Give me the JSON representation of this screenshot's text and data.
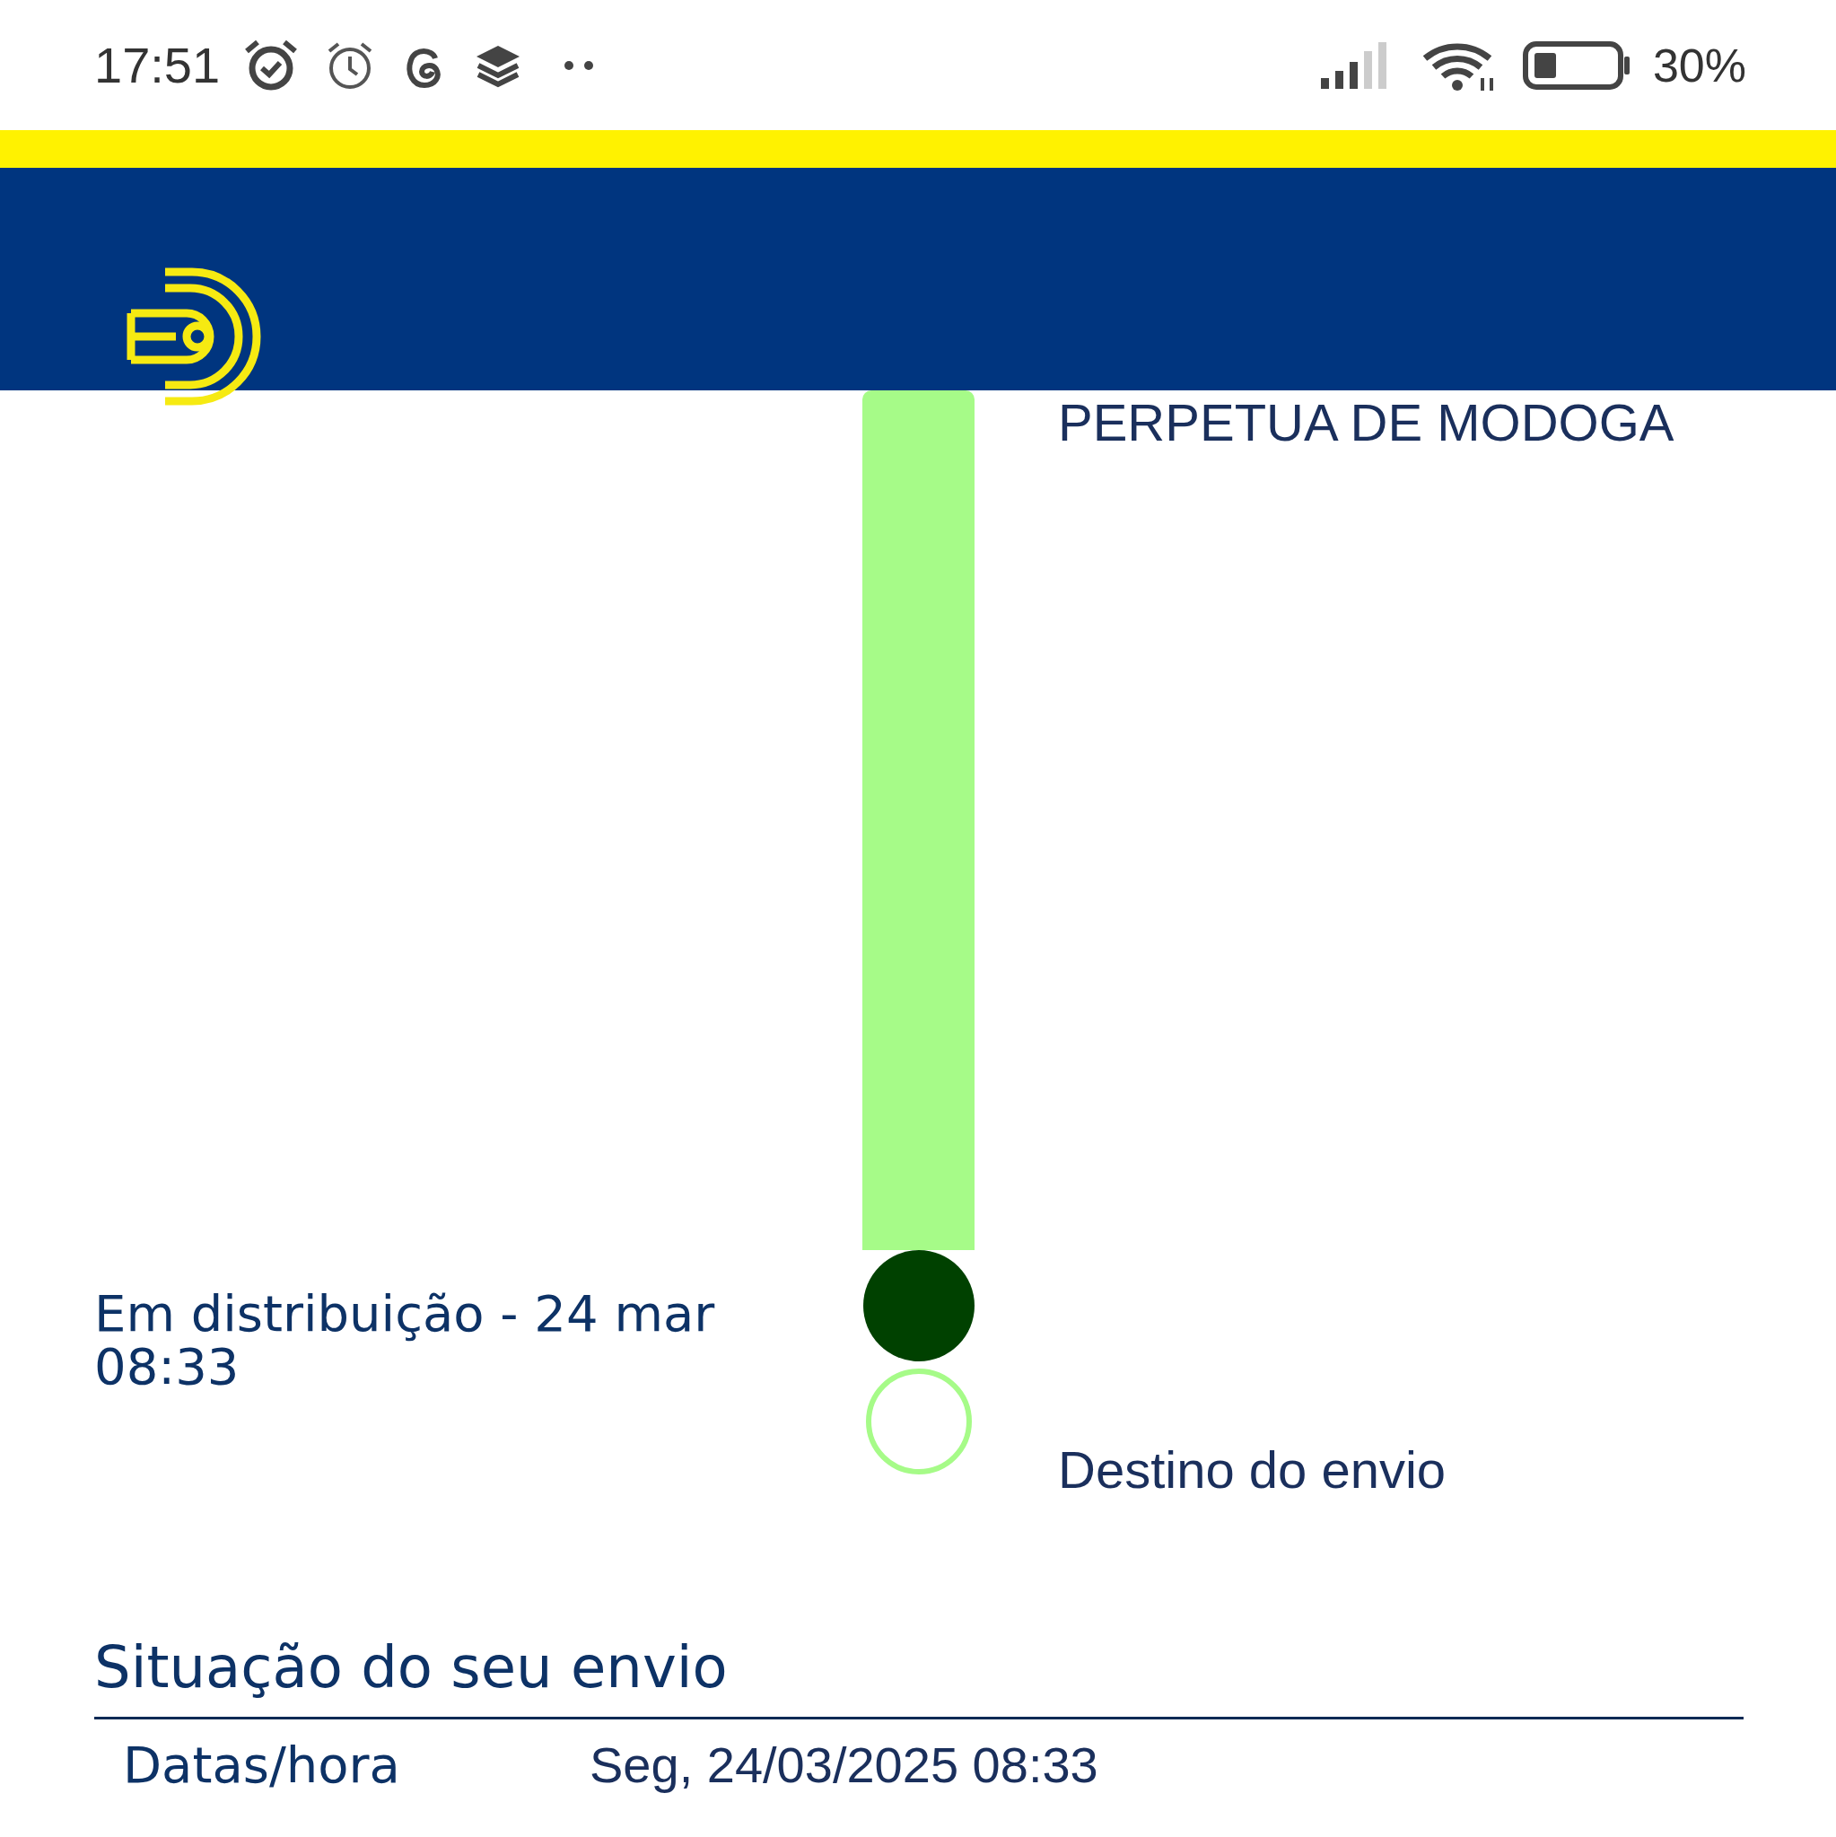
{
  "status_bar": {
    "time": "17:51",
    "battery": "30%"
  },
  "timeline": {
    "origin": "PERPETUA DE MODOGA",
    "stops": [
      {
        "kind": "current",
        "left_text": "Em distribuição - 24 mar 08:33"
      },
      {
        "kind": "pending",
        "right_text": "Destino do envio"
      }
    ]
  },
  "situation": {
    "title": "Situação do seu envio",
    "rows": [
      {
        "label": "Datas/hora",
        "value": "Seg, 24/03/2025 08:33"
      }
    ]
  }
}
